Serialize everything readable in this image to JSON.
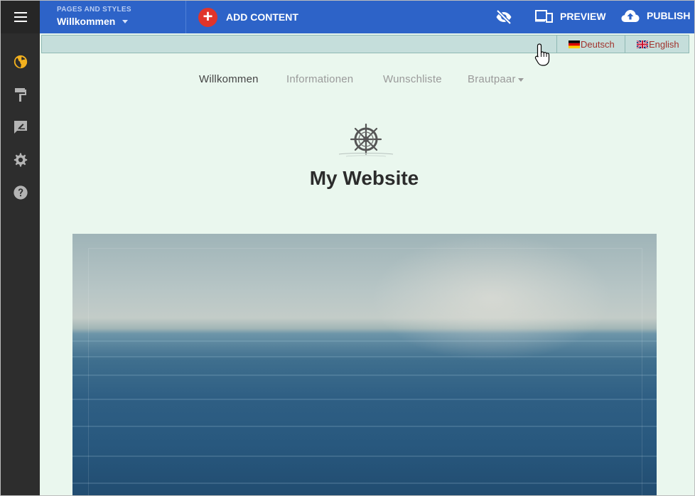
{
  "topbar": {
    "pages_caption": "PAGES AND STYLES",
    "pages_value": "Willkommen",
    "add_content_label": "ADD CONTENT",
    "preview_label": "PREVIEW",
    "publish_label": "PUBLISH"
  },
  "sidebar": {
    "icons": [
      "globe-icon",
      "paint-roller-icon",
      "edit-icon",
      "gear-icon",
      "help-icon"
    ],
    "active_color": "#f2b01e"
  },
  "languages": [
    {
      "label": "Deutsch",
      "flag": "de-flag-icon"
    },
    {
      "label": "English",
      "flag": "uk-flag-icon"
    }
  ],
  "site": {
    "nav": [
      "Willkommen",
      "Informationen",
      "Wunschliste",
      "Brautpaar"
    ],
    "active_nav": "Willkommen",
    "title": "My Website"
  },
  "colors": {
    "topbar": "#2d63c8",
    "rail": "#2d2d2d",
    "add_button": "#e0342b",
    "site_bg": "#eaf7ee",
    "lang_text": "#a1322c"
  }
}
